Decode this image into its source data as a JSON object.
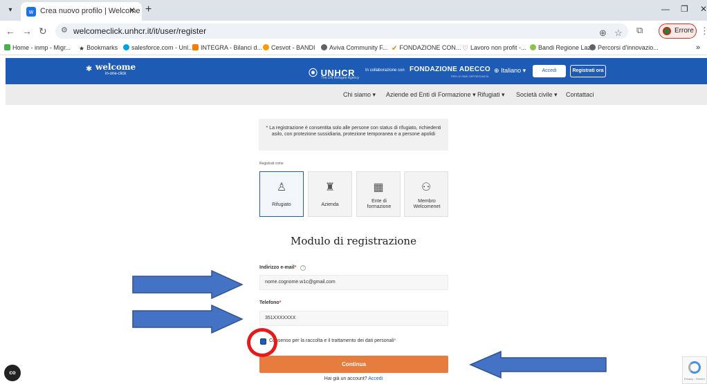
{
  "browser": {
    "tab_title": "Crea nuovo profilo | Welcome",
    "url": "welcomeclick.unhcr.it/it/user/register",
    "profile_status": "Errore",
    "bookmarks": [
      "Home - inmp - Migr...",
      "Bookmarks",
      "salesforce.com - Unl...",
      "INTEGRA - Bilanci d...",
      "Cesvot - BANDI",
      "Aviva Community F...",
      "FONDAZIONE CON...",
      "Lavoro non profit -...",
      "Bandi Regione Lazio",
      "Percorsi d'innovazio..."
    ]
  },
  "header": {
    "logo_main": "welcome",
    "logo_sub": "in-one-click",
    "partner1": "UNHCR",
    "partner1_sub": "The UN Refugee Agency",
    "collab": "In collaborazione con",
    "partner2": "FONDAZIONE ADECCO",
    "partner2_sub": "PER LE PARI OPPORTUNITÀ",
    "language": "Italiano",
    "login_label": "Accedi",
    "register_label": "Registrati ora"
  },
  "nav": [
    "Chi siamo",
    "Aziende ed Enti di Formazione",
    "Rifugiati",
    "Società civile",
    "Contattaci"
  ],
  "notice": "* La registrazione è consentita solo alle persone con status di rifugiato, richiedenti asilo, con protezione sussidiaria, protezione temporanea e a persone apolidi",
  "register_as_label": "Registrati come",
  "roles": [
    "Rifugiato",
    "Azienda",
    "Ente di formazione",
    "Membro Welcomenet"
  ],
  "selected_role": "Rifugiato",
  "form": {
    "title": "Modulo di registrazione",
    "email_label": "Indirizzo e-mail",
    "email_value": "nome.cognome.w1c@gmail.com",
    "phone_label": "Telefono",
    "phone_value": "351XXXXXXX",
    "consent_label": "Consenso per la raccolta e il trattamento dei dati personali",
    "consent_checked": true,
    "submit_label": "Continua",
    "already_text": "Hai già un account?",
    "login_link": "Accedi"
  },
  "recaptcha_text": "Privacy - Termini",
  "colors": {
    "header_blue": "#1e5bb5",
    "nav_grey": "#ececec",
    "continue_orange": "#e77c3f",
    "annotation_blue": "#4472c4",
    "annotation_red": "#e51b1b"
  }
}
